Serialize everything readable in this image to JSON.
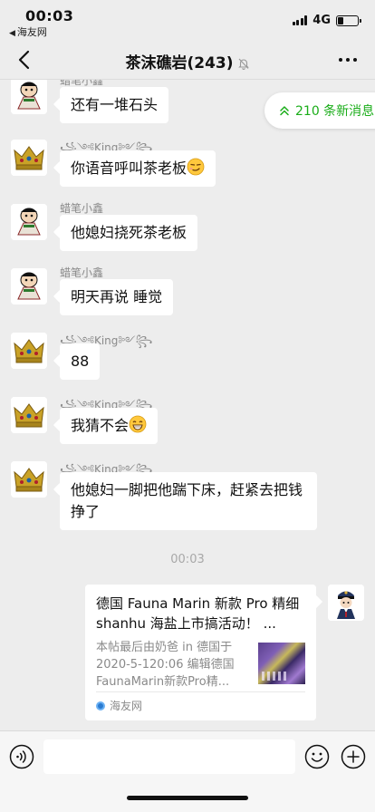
{
  "status": {
    "time": "00:03",
    "back_app": "海友网",
    "network": "4G"
  },
  "nav": {
    "title": "茶沫礁岩(243)"
  },
  "new_messages": {
    "label": "210 条新消息"
  },
  "messages": [
    {
      "sender": "蜡笔小鑫",
      "text": "还有一堆石头"
    },
    {
      "sender": "꧁༺King༻꧂",
      "text": "你语音呼叫茶老板"
    },
    {
      "sender": "蜡笔小鑫",
      "text": "他媳妇挠死茶老板"
    },
    {
      "sender": "蜡笔小鑫",
      "text": "明天再说 睡觉"
    },
    {
      "sender": "꧁༺King༻꧂",
      "text": "88"
    },
    {
      "sender": "꧁༺King༻꧂",
      "text": "我猜不会"
    },
    {
      "sender": "꧁༺King༻꧂",
      "text": "他媳妇一脚把他踹下床，赶紧去把钱挣了"
    }
  ],
  "divider_time": "00:03",
  "link_card": {
    "title": "德国 Fauna Marin 新款 Pro 精细 shanhu 海盐上市搞活动！ ...",
    "desc": "本帖最后由奶爸 in 德国于 2020-5-120:06 编辑德国 FaunaMarin新款Pro精...",
    "source": "海友网"
  },
  "icons": {
    "back": "chevron-left-icon",
    "mute": "bell-off-icon",
    "more": "more-dots-icon",
    "voice": "voice-icon",
    "emoji": "emoji-icon",
    "plus": "plus-icon",
    "new_messages": "double-chevron-up-icon"
  },
  "colors": {
    "accent": "#1aad19",
    "background": "#ededed",
    "bubble": "#ffffff"
  }
}
